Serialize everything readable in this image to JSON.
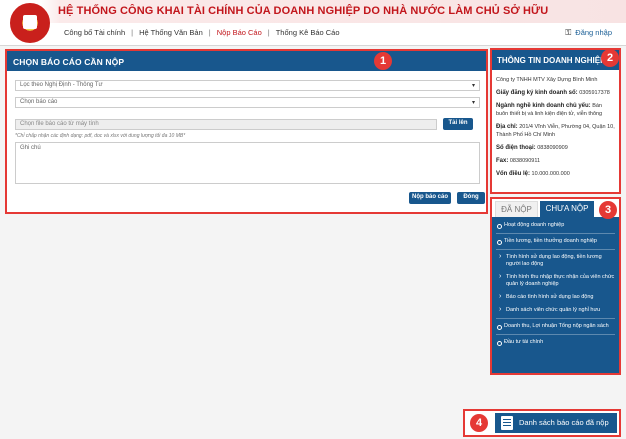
{
  "header": {
    "title": "HỆ THỐNG CÔNG KHAI TÀI CHÍNH CỦA DOANH NGHIỆP DO NHÀ NƯỚC LÀM CHỦ SỞ HỮU",
    "nav": [
      "Công bố Tài chính",
      "Hệ Thống Văn Bản",
      "Nộp Báo Cáo",
      "Thống Kê Báo Cáo"
    ],
    "active_nav": "Nộp Báo Cáo",
    "login": "Đăng nhập"
  },
  "form": {
    "title": "CHỌN BÁO CÁO CẦN NỘP",
    "filter_select": "Lọc theo Nghị Định - Thông Tư",
    "report_select": "Chọn báo cáo",
    "file_placeholder": "Chọn file báo cáo từ máy tính",
    "upload_button": "Tải lên",
    "hint": "*Chỉ chấp nhận các định dạng: pdf, doc và xlsx với dung lượng tối đa 10 MB*",
    "note_placeholder": "Ghi chú",
    "submit_button": "Nộp báo cáo",
    "close_button": "Đóng"
  },
  "company": {
    "title": "THÔNG TIN DOANH NGHIỆP",
    "name": "Công ty TNHH MTV Xây Dựng Bình Minh",
    "license_label": "Giấy đăng ký kinh doanh số:",
    "license": "0305917378",
    "business_label": "Ngành nghề kinh doanh chủ yếu:",
    "business": "Bán buôn thiết bị và linh kiện điện tử, viễn thông",
    "address_label": "Địa chỉ:",
    "address": "201/4 Vĩnh Viễn, Phường 04, Quận 10, Thành Phố Hồ Chí Minh",
    "phone_label": "Số điện thoại:",
    "phone": "0838090909",
    "fax_label": "Fax:",
    "fax": "0838090911",
    "capital_label": "Vốn điều lệ:",
    "capital": "10.000.000.000"
  },
  "tabs": {
    "done": "ĐÃ NỘP",
    "pending": "CHƯA NỘP"
  },
  "pending_items": [
    "Hoạt động doanh nghiệp",
    "Tiền lương, tiền thưởng doanh nghiệp",
    "Tình hình sử dụng lao động, tiền lương người lao động",
    "Tình hình thu nhập thực nhận của viên chức quản lý doanh nghiệp",
    "Báo cáo tình hình sử dụng lao động",
    "Danh sách viên chức quản lý nghỉ hưu",
    "Doanh thu, Lợi nhuận Tổng nộp ngân sách",
    "Đầu tư tài chính"
  ],
  "bottom_button": "Danh sách báo cáo đã nộp",
  "badges": [
    "1",
    "2",
    "3",
    "4"
  ],
  "colors": {
    "primary": "#18578d",
    "accent": "#c2161c",
    "highlight": "#e53935"
  }
}
